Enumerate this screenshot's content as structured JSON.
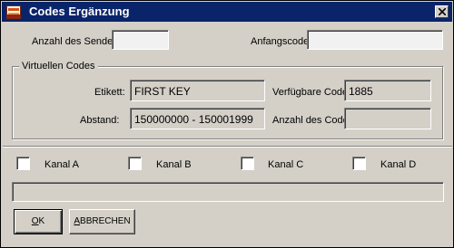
{
  "window": {
    "title": "Codes Ergänzung",
    "icon": "app-logo-icon",
    "close_icon": "close-icon"
  },
  "top_fields": {
    "senders_label": "Anzahl des Senders:",
    "senders_value": "",
    "start_code_label": "Anfangscode:",
    "start_code_value": ""
  },
  "virtual_codes": {
    "group_title": "Virtuellen Codes",
    "label_label": "Etikett:",
    "label_value": "FIRST KEY",
    "available_label": "Verfügbare Codes:",
    "available_value": "1885",
    "range_label": "Abstand:",
    "range_value": "150000000 - 150001999",
    "count_label": "Anzahl des Codes:",
    "count_value": ""
  },
  "channels": [
    {
      "label": "Kanal A",
      "checked": false
    },
    {
      "label": "Kanal B",
      "checked": false
    },
    {
      "label": "Kanal C",
      "checked": false
    },
    {
      "label": "Kanal D",
      "checked": false
    }
  ],
  "status_bar": {
    "text": ""
  },
  "buttons": {
    "ok_label_mnemonic": "O",
    "ok_label_rest": "K",
    "cancel_label_mnemonic": "A",
    "cancel_label_rest": "BBRECHEN"
  },
  "colors": {
    "titlebar": "#0a246a",
    "face": "#d4d0c8",
    "field": "#f1f1f1"
  }
}
